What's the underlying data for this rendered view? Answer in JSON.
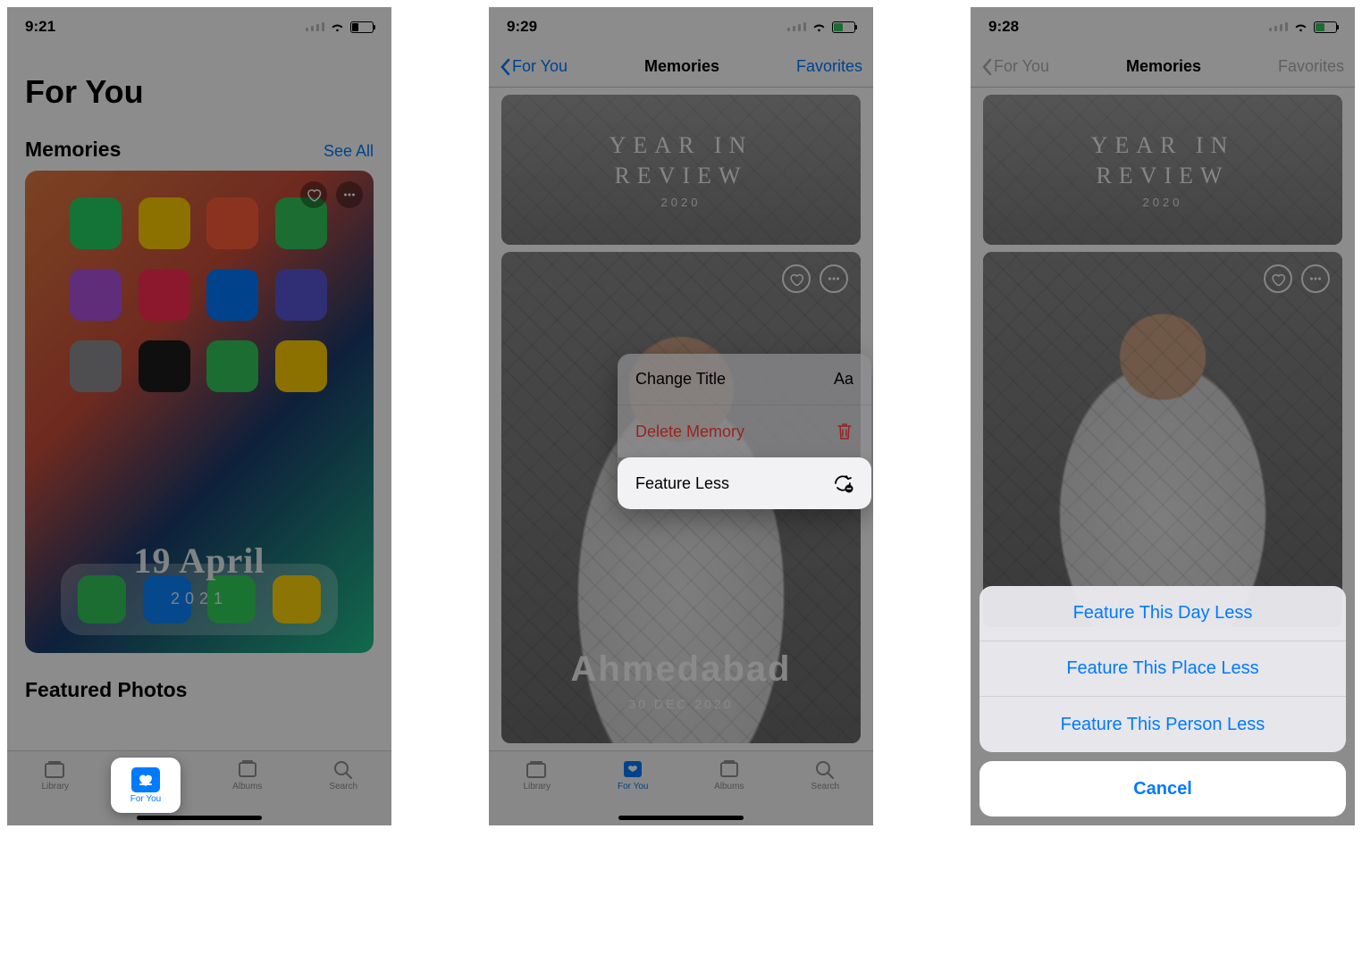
{
  "screen1": {
    "status_time": "9:21",
    "title": "For You",
    "section_memories": "Memories",
    "see_all": "See All",
    "memory_date": "19 April",
    "memory_year": "2021",
    "section_featured": "Featured Photos",
    "tabs": {
      "library": "Library",
      "for_you": "For You",
      "albums": "Albums",
      "search": "Search"
    }
  },
  "screen2": {
    "status_time": "9:29",
    "nav_back": "For You",
    "nav_title": "Memories",
    "nav_right": "Favorites",
    "banner_line1": "YEAR IN",
    "banner_line2": "REVIEW",
    "banner_year": "2020",
    "memory_place": "Ahmedabad",
    "memory_date": "30 DEC 2020",
    "menu": {
      "change_title": "Change Title",
      "change_title_glyph": "Aa",
      "delete_memory": "Delete Memory",
      "feature_less": "Feature Less"
    },
    "tabs": {
      "library": "Library",
      "for_you": "For You",
      "albums": "Albums",
      "search": "Search"
    }
  },
  "screen3": {
    "status_time": "9:28",
    "nav_back": "For You",
    "nav_title": "Memories",
    "nav_right": "Favorites",
    "banner_line1": "YEAR IN",
    "banner_line2": "REVIEW",
    "banner_year": "2020",
    "sheet": {
      "day": "Feature This Day Less",
      "place": "Feature This Place Less",
      "person": "Feature This Person Less",
      "cancel": "Cancel"
    }
  }
}
